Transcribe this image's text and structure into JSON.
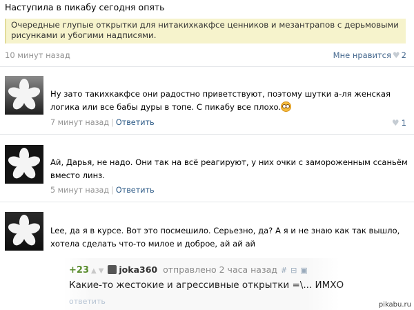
{
  "post": {
    "title": "Наступила в пикабу сегодня опять",
    "quote": "Очередные глупые открытки для нитакихкакфсе ценников и мезантрапов с дерьмовыми рисунками и убогими надписями.",
    "time": "10 минут назад",
    "like_label": "Мне нравится",
    "like_count": "2"
  },
  "comments": [
    {
      "text": "Ну зато такихкакфсе они радостно приветствуют, поэтому шутки а-ля женская логика или все бабы дуры в топе. С пикабу все плохо.",
      "time": "7 минут назад",
      "reply_label": "Ответить",
      "likes": "1",
      "emoji": "smirk-emoji-icon"
    },
    {
      "text": "Ай, Дарья, не надо. Они так на всё реагируют, у них очки с замороженным ссаньём вместо линз.",
      "time": "5 минут назад",
      "reply_label": "Ответить"
    },
    {
      "text": "Lee, да я в курсе. Вот это посмешило. Серьезно, да? А я и не знаю как так вышло, хотела сделать что-то милое и доброе, ай ай ай"
    }
  ],
  "pikabu_snippet": {
    "score": "+23",
    "username": "joka360",
    "posted": "отправлено 2 часа назад",
    "hash": "#",
    "text": "Какие-то жестокие и агрессивные открытки =\\... ИМХО",
    "reply": "ответить"
  },
  "watermark": "pikabu.ru",
  "colors": {
    "quote_bg": "#f6f3cc",
    "link": "#2a5885",
    "meta": "#939393",
    "pikabu_score": "#5a8d2e"
  }
}
